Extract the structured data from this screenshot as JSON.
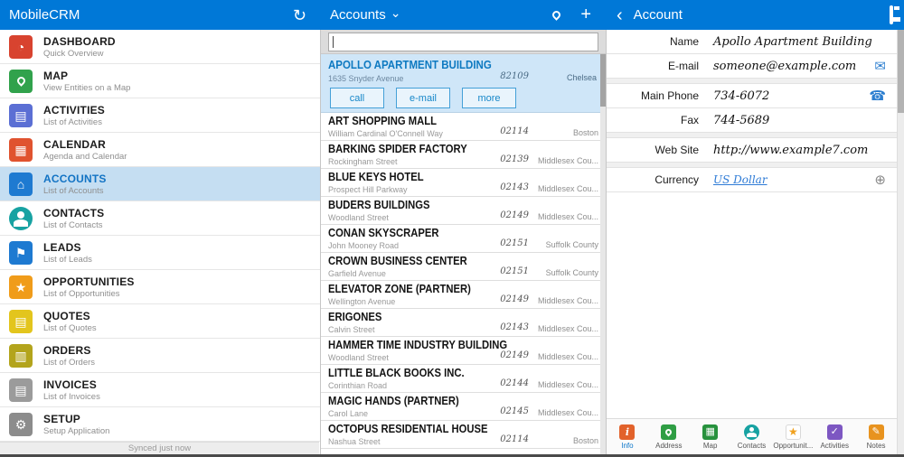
{
  "colors": {
    "accent": "#0078d7",
    "selection_bg": "#c5def2",
    "link": "#1787c9"
  },
  "icons": {
    "sync": "↻",
    "chevron_down": "⌄",
    "add": "+",
    "back": "‹",
    "dashboard": "◔",
    "activities": "▤",
    "calendar": "▦",
    "accounts": "⌂",
    "leads": "⚑",
    "opportunities": "★",
    "quotes": "▤",
    "orders": "▥",
    "invoices": "▤",
    "setup": "⚙",
    "email": "✉",
    "phone": "☎",
    "add_circle": "⊕",
    "map_grid": "▦",
    "check": "✓",
    "pencil": "✎",
    "info": "i",
    "star": "★"
  },
  "header": {
    "app_title": "MobileCRM",
    "list_title": "Accounts",
    "detail_title": "Account"
  },
  "sidebar": {
    "items": [
      {
        "title": "DASHBOARD",
        "subtitle": "Quick Overview",
        "icon": "dashboard-icon"
      },
      {
        "title": "MAP",
        "subtitle": "View Entities on a Map",
        "icon": "map-pin-icon"
      },
      {
        "title": "ACTIVITIES",
        "subtitle": "List of Activities",
        "icon": "activities-icon"
      },
      {
        "title": "CALENDAR",
        "subtitle": "Agenda and Calendar",
        "icon": "calendar-icon"
      },
      {
        "title": "ACCOUNTS",
        "subtitle": "List of Accounts",
        "icon": "accounts-icon",
        "selected": true
      },
      {
        "title": "CONTACTS",
        "subtitle": "List of Contacts",
        "icon": "contacts-icon"
      },
      {
        "title": "LEADS",
        "subtitle": "List of Leads",
        "icon": "leads-icon"
      },
      {
        "title": "OPPORTUNITIES",
        "subtitle": "List of Opportunities",
        "icon": "opportunities-icon"
      },
      {
        "title": "QUOTES",
        "subtitle": "List of Quotes",
        "icon": "quotes-icon"
      },
      {
        "title": "ORDERS",
        "subtitle": "List of Orders",
        "icon": "orders-icon"
      },
      {
        "title": "INVOICES",
        "subtitle": "List of Invoices",
        "icon": "invoices-icon"
      },
      {
        "title": "SETUP",
        "subtitle": "Setup Application",
        "icon": "setup-icon"
      }
    ],
    "footer": "Synced just now"
  },
  "accounts": {
    "search_value": "",
    "selected": {
      "name": "APOLLO APARTMENT BUILDING",
      "street": "1635 Snyder Avenue",
      "zip": "82109",
      "city": "Chelsea",
      "actions": [
        "call",
        "e-mail",
        "more"
      ]
    },
    "items": [
      {
        "name": "ART SHOPPING MALL",
        "street": "William Cardinal O'Connell Way",
        "zip": "02114",
        "city": "Boston"
      },
      {
        "name": "BARKING SPIDER FACTORY",
        "street": "Rockingham Street",
        "zip": "02139",
        "city": "Middlesex Cou..."
      },
      {
        "name": "BLUE KEYS HOTEL",
        "street": "Prospect Hill Parkway",
        "zip": "02143",
        "city": "Middlesex Cou..."
      },
      {
        "name": "BUDERS BUILDINGS",
        "street": "Woodland Street",
        "zip": "02149",
        "city": "Middlesex Cou..."
      },
      {
        "name": "CONAN SKYSCRAPER",
        "street": "John Mooney Road",
        "zip": "02151",
        "city": "Suffolk County"
      },
      {
        "name": "CROWN BUSINESS CENTER",
        "street": "Garfield Avenue",
        "zip": "02151",
        "city": "Suffolk County"
      },
      {
        "name": "ELEVATOR ZONE (PARTNER)",
        "street": "Wellington Avenue",
        "zip": "02149",
        "city": "Middlesex Cou..."
      },
      {
        "name": "ERIGONES",
        "street": "Calvin Street",
        "zip": "02143",
        "city": "Middlesex Cou..."
      },
      {
        "name": "HAMMER TIME INDUSTRY BUILDING",
        "street": "Woodland Street",
        "zip": "02149",
        "city": "Middlesex Cou..."
      },
      {
        "name": "LITTLE BLACK BOOKS INC.",
        "street": "Corinthian Road",
        "zip": "02144",
        "city": "Middlesex Cou..."
      },
      {
        "name": "MAGIC HANDS (PARTNER)",
        "street": "Carol Lane",
        "zip": "02145",
        "city": "Middlesex Cou..."
      },
      {
        "name": "OCTOPUS RESIDENTIAL HOUSE",
        "street": "Nashua Street",
        "zip": "02114",
        "city": "Boston"
      }
    ]
  },
  "detail": {
    "fields": [
      {
        "label": "Name",
        "value": "Apollo Apartment Building"
      },
      {
        "label": "E-mail",
        "value": "someone@example.com",
        "icon": "email-icon"
      },
      {
        "label": "Main Phone",
        "value": "734-6072",
        "icon": "phone-icon"
      },
      {
        "label": "Fax",
        "value": "744-5689"
      },
      {
        "label": "Web Site",
        "value": "http://www.example7.com"
      },
      {
        "label": "Currency",
        "value": "US Dollar",
        "icon": "add-circle-icon"
      }
    ],
    "tabs": [
      {
        "label": "Info",
        "icon": "info-icon",
        "selected": true
      },
      {
        "label": "Address",
        "icon": "address-pin-icon"
      },
      {
        "label": "Map",
        "icon": "map-icon"
      },
      {
        "label": "Contacts",
        "icon": "contacts-icon"
      },
      {
        "label": "Opportunit...",
        "icon": "opportunities-icon"
      },
      {
        "label": "Activities",
        "icon": "activities-icon"
      },
      {
        "label": "Notes",
        "icon": "notes-icon"
      }
    ]
  }
}
